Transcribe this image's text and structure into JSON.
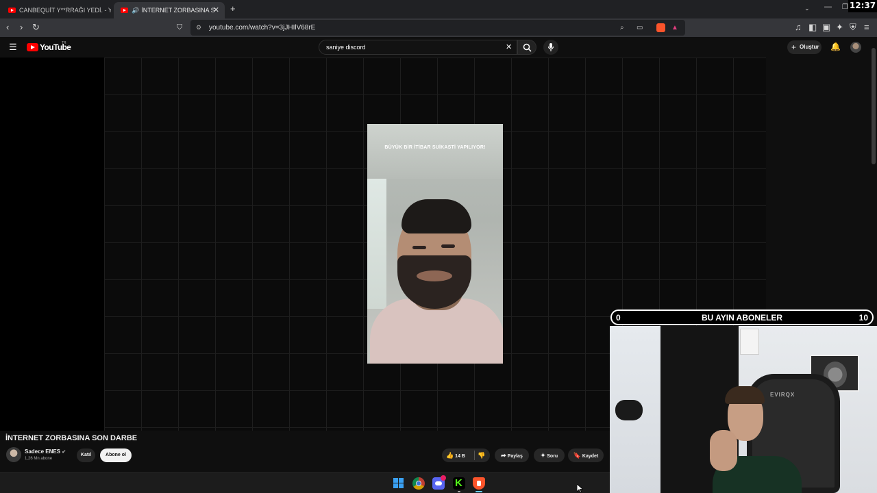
{
  "browser": {
    "tabs": [
      {
        "title": "CANBEQUİT Y**RRAĞI YEDİ. - YouTube",
        "active": false
      },
      {
        "title": "İNTERNET ZORBASINA SON DARBE - YouTube",
        "active": true
      }
    ],
    "new_tab": "+",
    "url": "youtube.com/watch?v=3jJHIlV68rE",
    "clock": "12:37"
  },
  "youtube": {
    "logo_text": "YouTube",
    "logo_region": "TR",
    "search_value": "saniye discord",
    "create_label": "Oluştur"
  },
  "video": {
    "overlay_text": "BÜYÜK BİR İTİBAR SUİKASTİ YAPILIYOR!",
    "title": "İNTERNET ZORBASINA SON DARBE",
    "channel_name": "Sadece ENES",
    "verified_icon": "verified-check",
    "subscribers": "1,26 Mn abone",
    "join_label": "Katıl",
    "subscribe_label": "Abone ol",
    "likes": "14 B",
    "share_label": "Paylaş",
    "ask_label": "Soru",
    "save_label": "Kaydet"
  },
  "overlay": {
    "left_count": "0",
    "title": "BU AYIN ABONELER",
    "right_count": "10"
  },
  "taskbar": {
    "apps": [
      "windows-start",
      "chrome",
      "discord",
      "kick",
      "brave"
    ]
  },
  "colors": {
    "youtube_red": "#ff0000",
    "background": "#0f0f0f",
    "kick_green": "#53fc18",
    "discord_blurple": "#5865f2",
    "brave_orange": "#fb542b"
  }
}
